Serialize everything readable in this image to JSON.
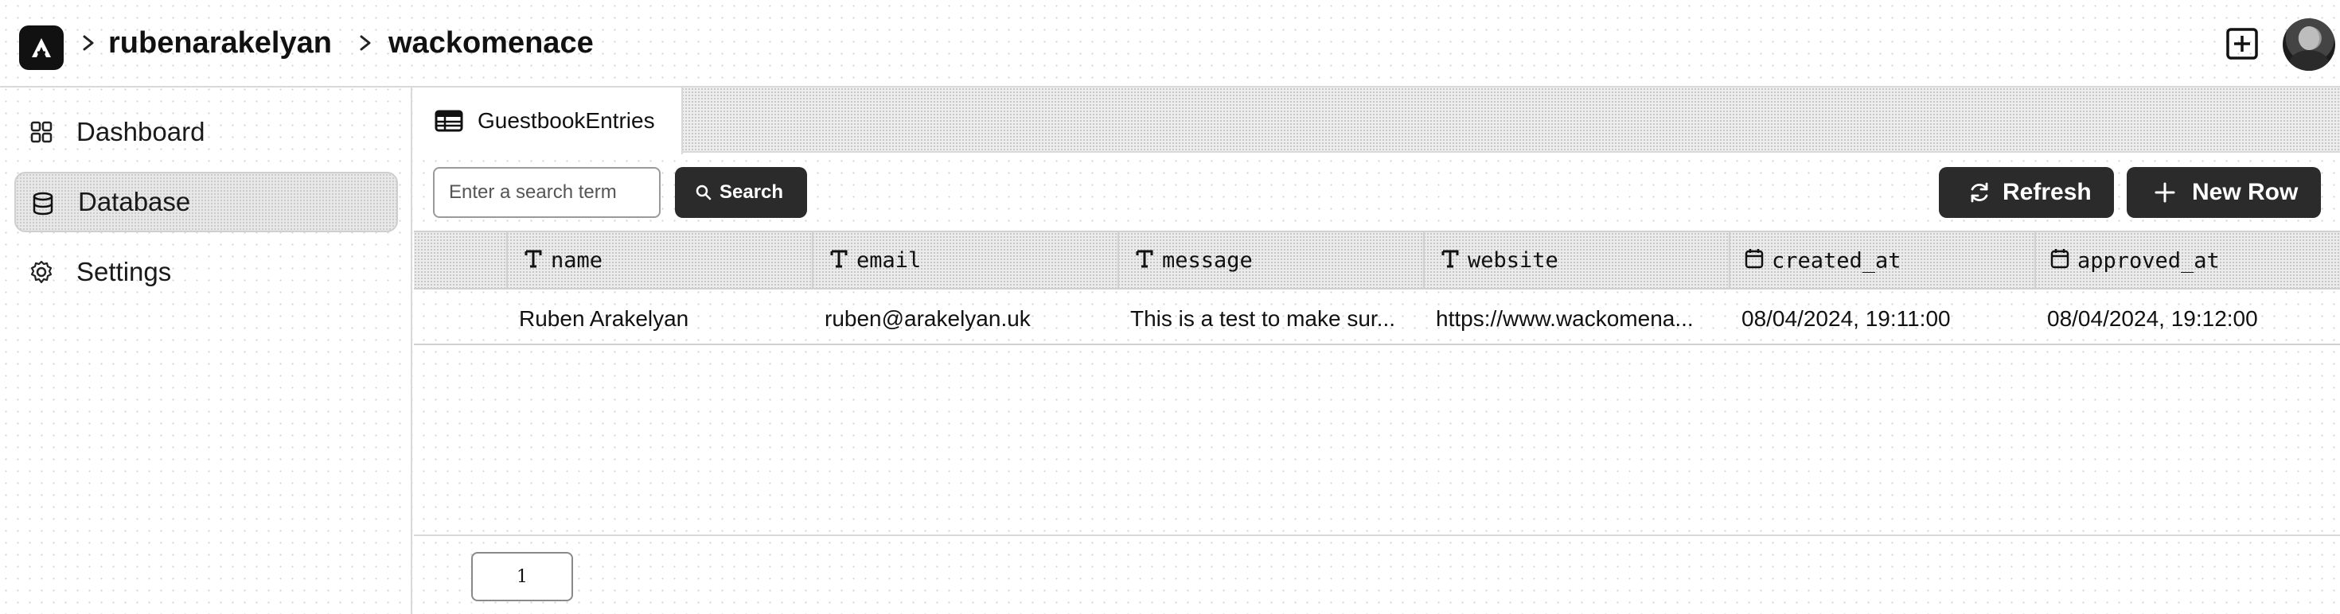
{
  "breadcrumb": {
    "logo": "A",
    "items": [
      {
        "label": "rubenarakelyan"
      },
      {
        "label": "wackomenace"
      }
    ]
  },
  "header_actions": {
    "add_icon": "square-plus-icon",
    "avatar": "user-avatar"
  },
  "sidebar": {
    "items": [
      {
        "label": "Dashboard",
        "icon": "grid-icon",
        "active": false
      },
      {
        "label": "Database",
        "icon": "database-icon",
        "active": true
      },
      {
        "label": "Settings",
        "icon": "gear-icon",
        "active": false
      }
    ]
  },
  "tabs": [
    {
      "label": "GuestbookEntries",
      "icon": "table-icon",
      "active": true
    }
  ],
  "toolbar": {
    "search_placeholder": "Enter a search term",
    "search_label": "Search",
    "refresh_label": "Refresh",
    "new_row_label": "New Row"
  },
  "table": {
    "columns": [
      {
        "name": "name",
        "type": "text"
      },
      {
        "name": "email",
        "type": "text"
      },
      {
        "name": "message",
        "type": "text"
      },
      {
        "name": "website",
        "type": "text"
      },
      {
        "name": "created_at",
        "type": "date"
      },
      {
        "name": "approved_at",
        "type": "date"
      }
    ],
    "rows": [
      {
        "name": "Ruben Arakelyan",
        "email": "ruben@arakelyan.uk",
        "message": "This is a test to make sur...",
        "website": "https://www.wackomena...",
        "created_at": "08/04/2024, 19:11:00",
        "approved_at": "08/04/2024, 19:12:00"
      }
    ]
  },
  "pagination": {
    "current_page": "1"
  }
}
